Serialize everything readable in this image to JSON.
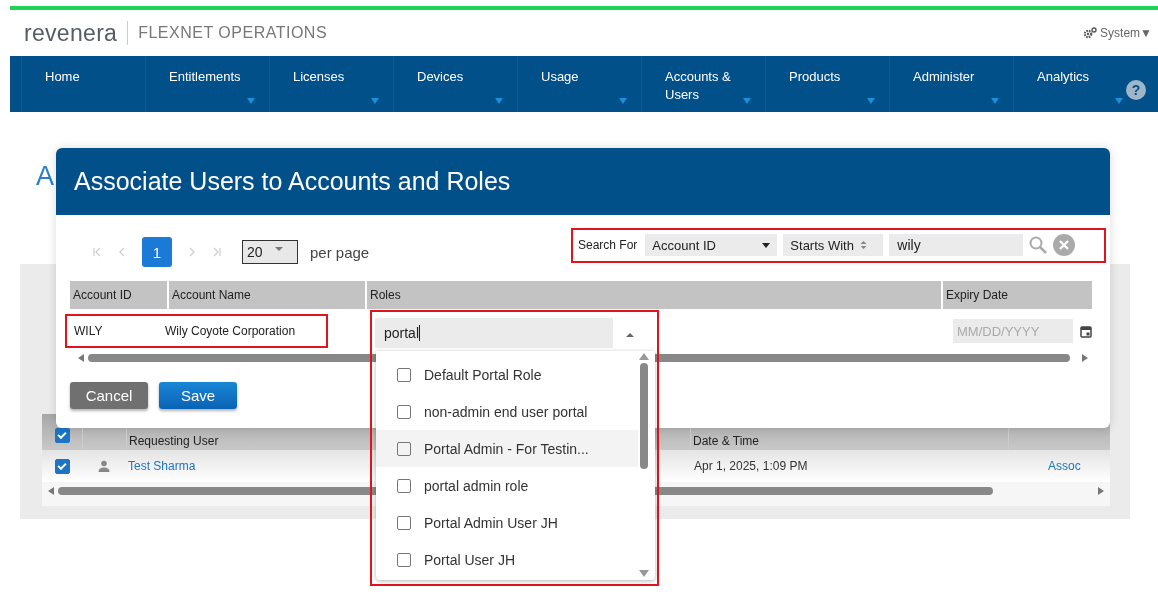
{
  "header": {
    "logo": "revenera",
    "product": "FLEXNET OPERATIONS",
    "user_menu": "System▼"
  },
  "nav": [
    {
      "label": "Home",
      "has_menu": false
    },
    {
      "label": "Entitlements",
      "has_menu": true
    },
    {
      "label": "Licenses",
      "has_menu": true
    },
    {
      "label": "Devices",
      "has_menu": true
    },
    {
      "label": "Usage",
      "has_menu": true
    },
    {
      "label": "Accounts & Users",
      "has_menu": true
    },
    {
      "label": "Products",
      "has_menu": true
    },
    {
      "label": "Administer",
      "has_menu": true
    },
    {
      "label": "Analytics",
      "has_menu": true
    }
  ],
  "help_button": "?",
  "page_heading": "A",
  "background_table": {
    "select_all_checked": true,
    "columns": [
      "Requesting User",
      "Date & Time"
    ],
    "rows": [
      {
        "checked": true,
        "requesting_user": "Test Sharma",
        "date_time": "Apr 1, 2025, 1:09 PM",
        "action": "Assoc"
      }
    ]
  },
  "dialog": {
    "title": "Associate Users to Accounts and Roles",
    "pagination": {
      "pages": [
        {
          "label": "1",
          "selected": true
        }
      ],
      "page_size": "20",
      "per_page_label": "per page"
    },
    "search": {
      "label": "Search For",
      "field": "Account ID",
      "operator": "Starts With",
      "value": "wily"
    },
    "table": {
      "columns": [
        "Account ID",
        "Account Name",
        "Roles",
        "Expiry Date"
      ],
      "rows": [
        {
          "account_id": "WILY",
          "account_name": "Wily Coyote Corporation",
          "roles_query": "portal",
          "expiry_placeholder": "MM/DD/YYYY"
        }
      ]
    },
    "buttons": [
      {
        "label": "Cancel",
        "kind": "secondary"
      },
      {
        "label": "Save",
        "kind": "primary"
      }
    ]
  },
  "roles_dropdown": {
    "expanded": true,
    "options": [
      {
        "label": "Default Portal Role",
        "checked": false,
        "highlighted": false
      },
      {
        "label": "non-admin end user portal",
        "checked": false,
        "highlighted": false
      },
      {
        "label": "Portal Admin - For Testin...",
        "checked": false,
        "highlighted": true
      },
      {
        "label": "portal admin role",
        "checked": false,
        "highlighted": false
      },
      {
        "label": "Portal Admin User JH",
        "checked": false,
        "highlighted": false
      },
      {
        "label": "Portal User JH",
        "checked": false,
        "highlighted": false
      }
    ]
  }
}
